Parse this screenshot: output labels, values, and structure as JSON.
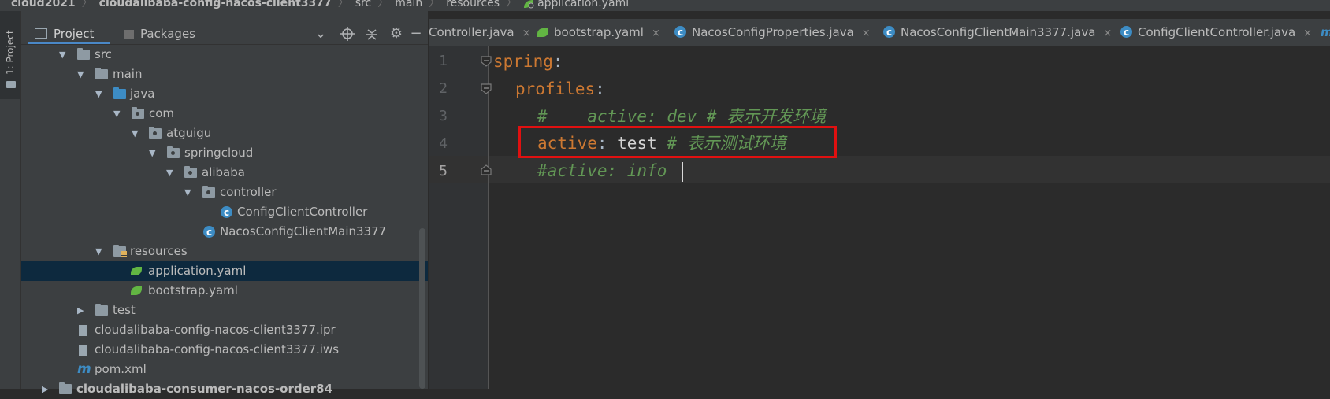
{
  "breadcrumb": {
    "items": [
      "cloud2021",
      "cloudalibaba-config-nacos-client3377",
      "src",
      "main",
      "resources",
      "application.yaml"
    ]
  },
  "tool_strip": {
    "project_label": "1: Project"
  },
  "project_panel": {
    "tabs": [
      "Project",
      "Packages"
    ],
    "tree": [
      {
        "label": "src"
      },
      {
        "label": "main"
      },
      {
        "label": "java"
      },
      {
        "label": "com"
      },
      {
        "label": "atguigu"
      },
      {
        "label": "springcloud"
      },
      {
        "label": "alibaba"
      },
      {
        "label": "controller"
      },
      {
        "label": "ConfigClientController"
      },
      {
        "label": "NacosConfigClientMain3377"
      },
      {
        "label": "resources"
      },
      {
        "label": "application.yaml"
      },
      {
        "label": "bootstrap.yaml"
      },
      {
        "label": "test"
      },
      {
        "label": "cloudalibaba-config-nacos-client3377.ipr"
      },
      {
        "label": "cloudalibaba-config-nacos-client3377.iws"
      },
      {
        "label": "pom.xml"
      },
      {
        "label": "cloudalibaba-consumer-nacos-order84"
      }
    ]
  },
  "editor": {
    "tabs": [
      {
        "label": "Controller.java",
        "close": "×"
      },
      {
        "label": "bootstrap.yaml",
        "close": "×"
      },
      {
        "label": "NacosConfigProperties.java",
        "close": "×"
      },
      {
        "label": "NacosConfigClientMain3377.java",
        "close": "×"
      },
      {
        "label": "ConfigClientController.java",
        "close": "×"
      },
      {
        "label": "m"
      }
    ],
    "line_numbers": [
      "1",
      "2",
      "3",
      "4",
      "5"
    ],
    "lines": {
      "l1_key": "spring",
      "l1_colon": ":",
      "l2_key": "profiles",
      "l2_colon": ":",
      "l3_comment": "#    active: dev # 表示开发环境",
      "l4_key": "active",
      "l4_colon": ": ",
      "l4_value": "test ",
      "l4_comment": "# 表示测试环境",
      "l5_comment": "#active: info"
    }
  },
  "colors": {
    "accent_highlight": "#e01010",
    "keyword": "#cc7832",
    "comment": "#629755"
  }
}
